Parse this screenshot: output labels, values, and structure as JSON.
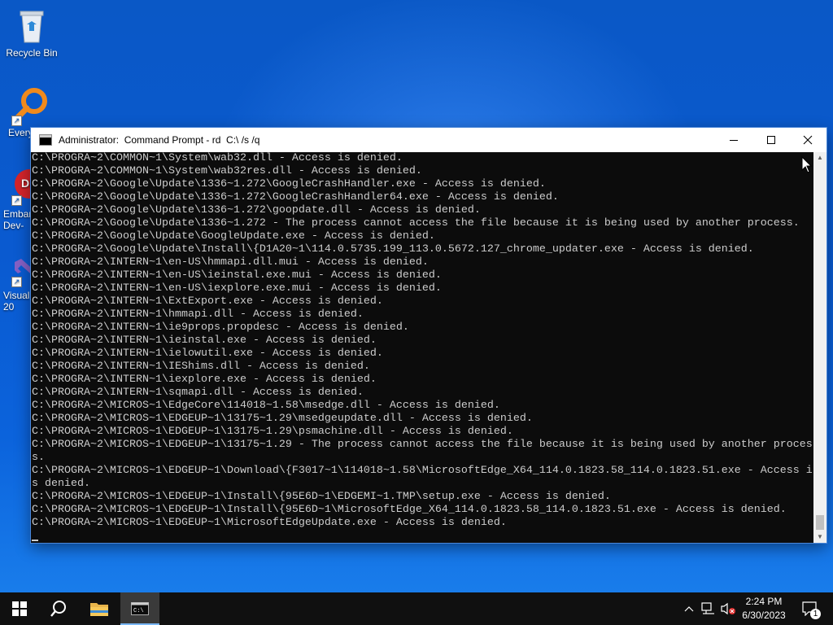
{
  "desktop": {
    "icons": [
      {
        "label": "Recycle Bin"
      },
      {
        "label": "Every"
      },
      {
        "label": "Embar\nDev-"
      },
      {
        "label": "Visual\n20"
      }
    ]
  },
  "window": {
    "title": "Administrator:  Command Prompt - rd  C:\\ /s /q",
    "lines": [
      "C:\\PROGRA~2\\COMMON~1\\System\\wab32.dll - Access is denied.",
      "C:\\PROGRA~2\\COMMON~1\\System\\wab32res.dll - Access is denied.",
      "C:\\PROGRA~2\\Google\\Update\\1336~1.272\\GoogleCrashHandler.exe - Access is denied.",
      "C:\\PROGRA~2\\Google\\Update\\1336~1.272\\GoogleCrashHandler64.exe - Access is denied.",
      "C:\\PROGRA~2\\Google\\Update\\1336~1.272\\goopdate.dll - Access is denied.",
      "C:\\PROGRA~2\\Google\\Update\\1336~1.272 - The process cannot access the file because it is being used by another process.",
      "C:\\PROGRA~2\\Google\\Update\\GoogleUpdate.exe - Access is denied.",
      "C:\\PROGRA~2\\Google\\Update\\Install\\{D1A20~1\\114.0.5735.199_113.0.5672.127_chrome_updater.exe - Access is denied.",
      "C:\\PROGRA~2\\INTERN~1\\en-US\\hmmapi.dll.mui - Access is denied.",
      "C:\\PROGRA~2\\INTERN~1\\en-US\\ieinstal.exe.mui - Access is denied.",
      "C:\\PROGRA~2\\INTERN~1\\en-US\\iexplore.exe.mui - Access is denied.",
      "C:\\PROGRA~2\\INTERN~1\\ExtExport.exe - Access is denied.",
      "C:\\PROGRA~2\\INTERN~1\\hmmapi.dll - Access is denied.",
      "C:\\PROGRA~2\\INTERN~1\\ie9props.propdesc - Access is denied.",
      "C:\\PROGRA~2\\INTERN~1\\ieinstal.exe - Access is denied.",
      "C:\\PROGRA~2\\INTERN~1\\ielowutil.exe - Access is denied.",
      "C:\\PROGRA~2\\INTERN~1\\IEShims.dll - Access is denied.",
      "C:\\PROGRA~2\\INTERN~1\\iexplore.exe - Access is denied.",
      "C:\\PROGRA~2\\INTERN~1\\sqmapi.dll - Access is denied.",
      "C:\\PROGRA~2\\MICROS~1\\EdgeCore\\114018~1.58\\msedge.dll - Access is denied.",
      "C:\\PROGRA~2\\MICROS~1\\EDGEUP~1\\13175~1.29\\msedgeupdate.dll - Access is denied.",
      "C:\\PROGRA~2\\MICROS~1\\EDGEUP~1\\13175~1.29\\psmachine.dll - Access is denied.",
      "C:\\PROGRA~2\\MICROS~1\\EDGEUP~1\\13175~1.29 - The process cannot access the file because it is being used by another proces",
      "s.",
      "C:\\PROGRA~2\\MICROS~1\\EDGEUP~1\\Download\\{F3017~1\\114018~1.58\\MicrosoftEdge_X64_114.0.1823.58_114.0.1823.51.exe - Access i",
      "s denied.",
      "C:\\PROGRA~2\\MICROS~1\\EDGEUP~1\\Install\\{95E6D~1\\EDGEMI~1.TMP\\setup.exe - Access is denied.",
      "C:\\PROGRA~2\\MICROS~1\\EDGEUP~1\\Install\\{95E6D~1\\MicrosoftEdge_X64_114.0.1823.58_114.0.1823.51.exe - Access is denied.",
      "C:\\PROGRA~2\\MICROS~1\\EDGEUP~1\\MicrosoftEdgeUpdate.exe - Access is denied."
    ]
  },
  "taskbar": {
    "time": "2:24 PM",
    "date": "6/30/2023",
    "notification_count": "1"
  },
  "colors": {
    "console_bg": "#0c0c0c",
    "console_text": "#cccccc",
    "taskbar_bg": "#101010"
  }
}
